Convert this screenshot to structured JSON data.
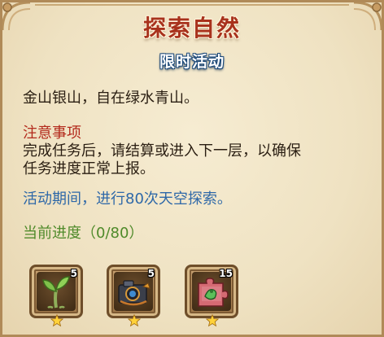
{
  "header": {
    "title": "探索自然",
    "subtitle": "限时活动"
  },
  "content": {
    "intro": "金山银山，自在绿水青山。",
    "note_title": "注意事项",
    "note_lines": [
      "完成任务后，请结算或进入下一层，以确保",
      "任务进度正常上报。"
    ],
    "event_desc": "活动期间，进行80次天空探索。",
    "progress": "当前进度（0/80）"
  },
  "rewards": [
    {
      "icon": "sprout-icon",
      "count": "5"
    },
    {
      "icon": "camera-icon",
      "count": "5"
    },
    {
      "icon": "puzzle-piece-icon",
      "count": "15"
    }
  ],
  "colors": {
    "title": "#a8321c",
    "subtitle_outline": "#1d4a7a",
    "note_title": "#b32a1c",
    "event": "#2e68a8",
    "progress": "#4f8a2a",
    "parchment": "#f3e7c9"
  }
}
